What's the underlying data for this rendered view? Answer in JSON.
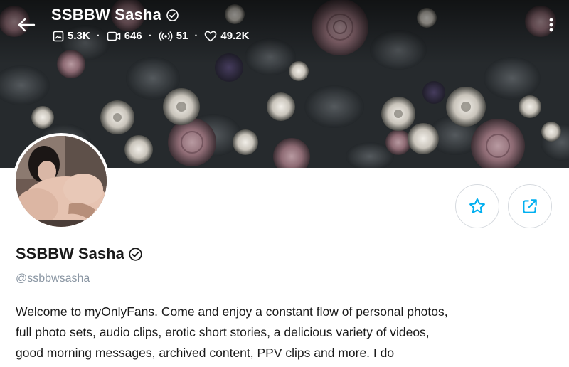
{
  "header": {
    "name": "SSBBW Sasha",
    "stats": {
      "photos": "5.3K",
      "videos": "646",
      "streams": "51",
      "likes": "49.2K"
    },
    "separator": "·"
  },
  "profile": {
    "name": "SSBBW Sasha",
    "handle": "@ssbbwsasha",
    "bio_lines": [
      "Welcome to myOnlyFans. Come and enjoy a constant flow of personal photos,",
      "full photo sets, audio clips, erotic short stories, a delicious variety of videos,",
      "good morning messages, archived content, PPV clips and more. I do"
    ]
  },
  "icons": {
    "back": "arrow-left-icon",
    "verified": "verified-badge-icon",
    "photos": "image-icon",
    "videos": "video-icon",
    "streams": "broadcast-icon",
    "likes": "heart-icon",
    "more": "more-vertical-icon",
    "favorite": "star-icon",
    "share": "share-icon"
  },
  "colors": {
    "accent": "#00aff0",
    "text": "#1a1a1a",
    "muted": "#8a96a3",
    "cover": "#1c1f22"
  }
}
